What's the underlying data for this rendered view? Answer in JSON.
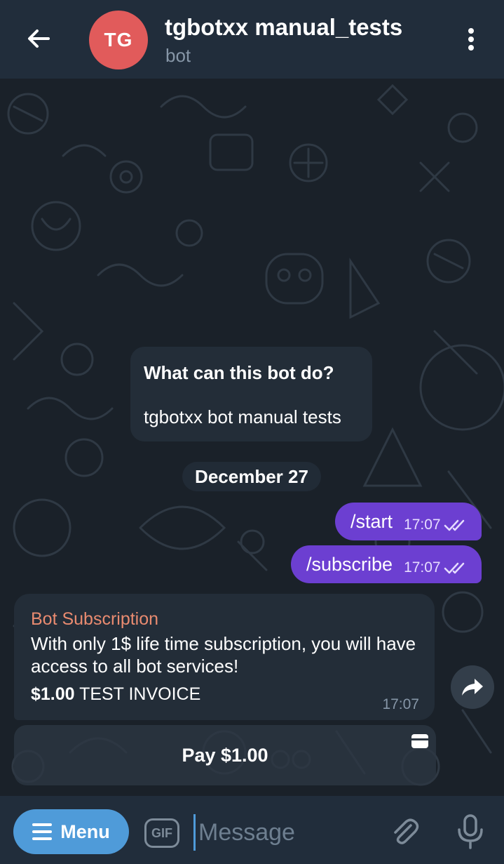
{
  "header": {
    "back_icon": "arrow-left-icon",
    "avatar_initials": "TG",
    "avatar_color": "#e15b5b",
    "title": "tgbotxx manual_tests",
    "subtitle": "bot",
    "more_icon": "more-vertical-icon"
  },
  "intro": {
    "title": "What can this bot do?",
    "text": "tgbotxx bot manual tests"
  },
  "date_divider": "December 27",
  "messages": [
    {
      "text": "/start",
      "time": "17:07",
      "status": "read"
    },
    {
      "text": "/subscribe",
      "time": "17:07",
      "status": "read"
    }
  ],
  "invoice": {
    "title": "Bot Subscription",
    "description": "With only 1$ life time subscription, you will have access to all bot services!",
    "amount": "$1.00",
    "label": "TEST INVOICE",
    "time": "17:07",
    "pay_button": "Pay $1.00",
    "share_icon": "share-arrow-icon",
    "card_icon": "credit-card-icon"
  },
  "input_bar": {
    "menu_label": "Menu",
    "gif_label": "GIF",
    "placeholder": "Message",
    "attach_icon": "paperclip-icon",
    "mic_icon": "microphone-icon"
  },
  "colors": {
    "header_bg": "#212d3b",
    "outgoing_bubble": "#6c3fd1",
    "incoming_bubble": "#232d38",
    "invoice_title": "#e98b70",
    "menu_button": "#4f9bd9"
  }
}
